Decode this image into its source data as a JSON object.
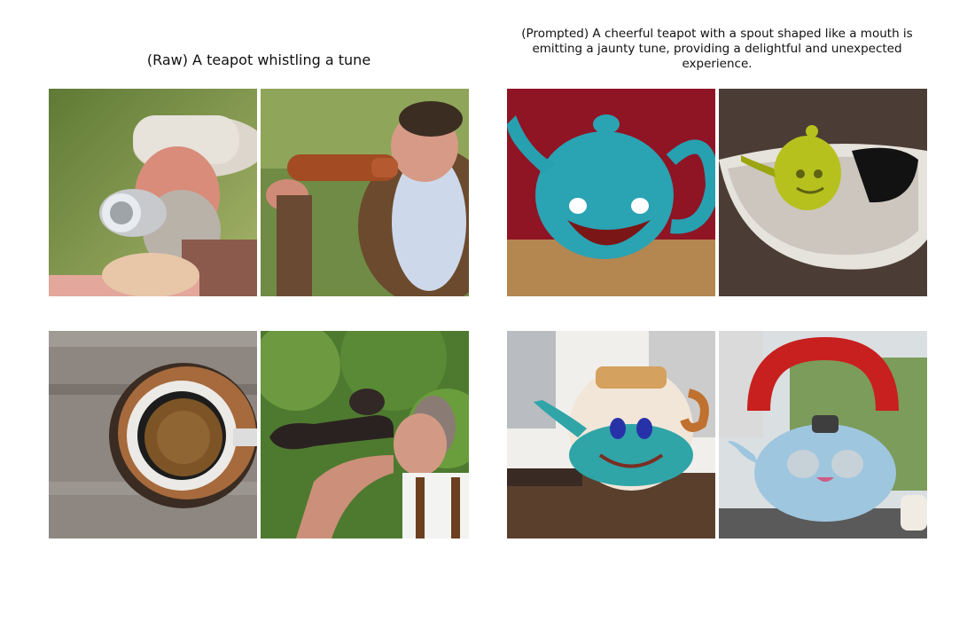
{
  "figure": {
    "left_title": "(Raw) A teapot whistling a tune",
    "right_title": "(Prompted) A cheerful teapot with a spout shaped like a mouth is emitting a jaunty tune, providing a delightful and unexpected experience."
  },
  "images": {
    "raw": [
      {
        "subject": "old man with beard and hat holding a silver horn-like teapot to his mouth"
      },
      {
        "subject": "man in brown jacket drinking from a brown bottle"
      },
      {
        "subject": "top-down cup of tea on a wooden table"
      },
      {
        "subject": "man playing a dark horn-shaped teapot outdoors"
      }
    ],
    "prompted": [
      {
        "subject": "turquoise cartoon teapot with grinning mouth on wooden table"
      },
      {
        "subject": "yellow-green smiling teapot in a white dish"
      },
      {
        "subject": "white and turquoise teapot with blue eyes and a smile"
      },
      {
        "subject": "light blue teapot with a red arched handle"
      }
    ]
  }
}
